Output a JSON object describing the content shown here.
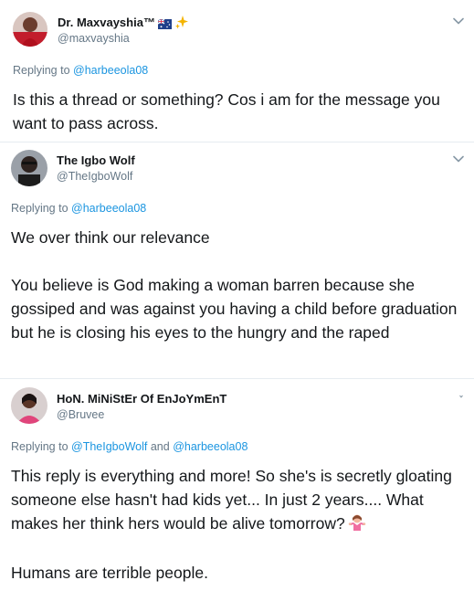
{
  "tweets": [
    {
      "display_name": "Dr. Maxvayshia™",
      "handle": "@maxvayshia",
      "replying_prefix": "Replying to",
      "mentions": [
        "@harbeeola08"
      ],
      "mention_joiner": "",
      "text": "Is this a thread or something? Cos i am for the message you want to pass across."
    },
    {
      "display_name": "The Igbo Wolf",
      "handle": "@TheIgboWolf",
      "replying_prefix": "Replying to",
      "mentions": [
        "@harbeeola08"
      ],
      "mention_joiner": "",
      "text_paragraphs": [
        "We over think our relevance",
        "You believe is God making a woman barren because she gossiped and was against you having a child before graduation but he is closing his eyes to the hungry and the raped"
      ]
    },
    {
      "display_name": "HoN. MiNiStEr Of EnJoYmEnT",
      "handle": "@Bruvee",
      "replying_prefix": "Replying to",
      "mentions": [
        "@TheIgboWolf",
        "@harbeeola08"
      ],
      "mention_joiner": "and",
      "text_paragraphs": [
        "This reply is everything and more! So she's is secretly gloating someone else hasn't had kids yet... In just 2 years.... What makes her think hers would be alive tomorrow?",
        "Humans are terrible people."
      ]
    }
  ],
  "icons": [
    "australia-flag-icon",
    "sparkles-icon",
    "chevron-down-icon",
    "woman-shrugging-emoji-icon"
  ],
  "colors": {
    "link": "#1b95e0",
    "muted": "#657786",
    "text": "#14171a",
    "divider": "#e6ecf0"
  }
}
